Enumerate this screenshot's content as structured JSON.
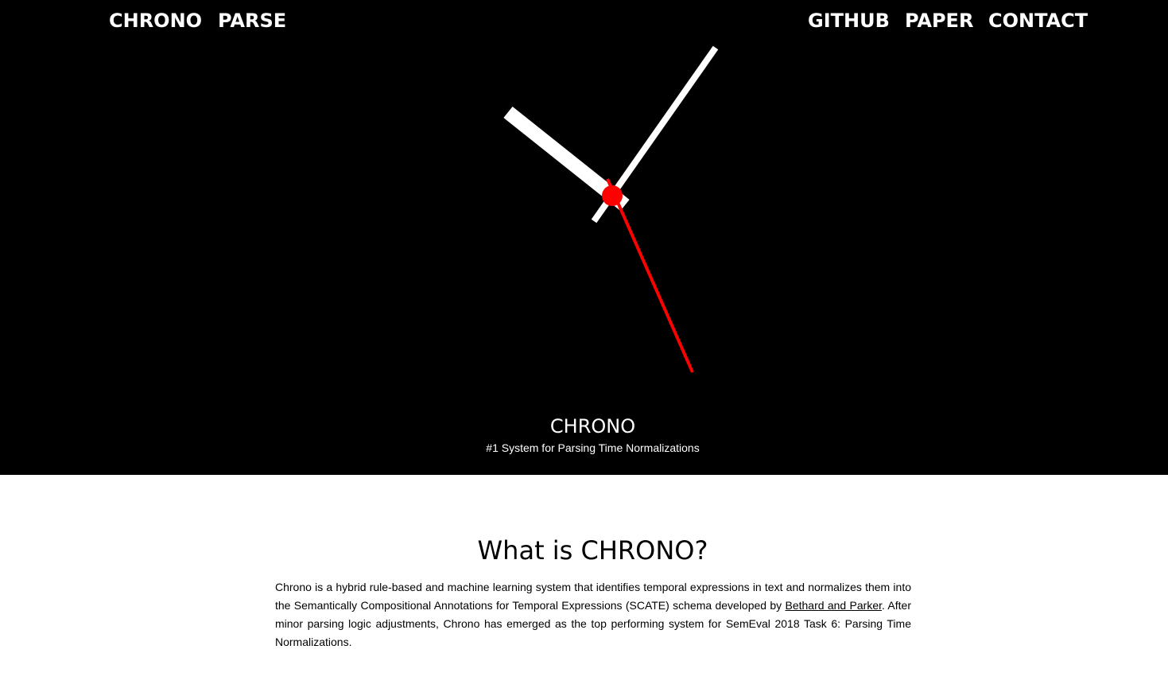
{
  "nav": {
    "brand": "CHRONO",
    "parse": "PARSE",
    "github": "GITHUB",
    "paper": "PAPER",
    "contact": "CONTACT"
  },
  "hero": {
    "title": "CHRONO",
    "subtitle": "#1 System for Parsing Time Normalizations"
  },
  "clock": {
    "hand_color": "#ffffff",
    "second_hand_color": "#ff0000",
    "center_color": "#ff0000"
  },
  "about": {
    "heading": "What is CHRONO?",
    "text_before_link": "Chrono is a hybrid rule-based and machine learning system that identifies temporal expressions in text and normalizes them into the Semantically Compositional Annotations for Temporal Expressions (SCATE) schema developed by ",
    "link_text": "Bethard and Parker",
    "text_after_link": ". After minor parsing logic adjustments, Chrono has emerged as the top performing system for SemEval 2018 Task 6: Parsing Time Normalizations."
  },
  "colors": {
    "hero_background": "#000000",
    "page_background": "#ffffff",
    "accent": "#ff0000"
  }
}
